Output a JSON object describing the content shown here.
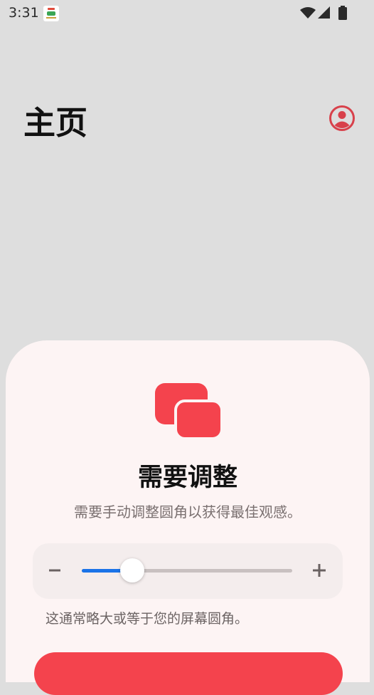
{
  "status_bar": {
    "time": "3:31",
    "icons": [
      "app-notification-icon",
      "wifi-icon",
      "signal-icon",
      "battery-icon"
    ]
  },
  "header": {
    "title": "主页",
    "account_icon": "account-circle-icon"
  },
  "sheet": {
    "title": "需要调整",
    "subtitle": "需要手动调整圆角以获得最佳观感。",
    "hint": "这通常略大或等于您的屏幕圆角。",
    "slider": {
      "value_fraction": 0.24,
      "decrease_icon": "minus-icon",
      "increase_icon": "plus-icon"
    },
    "primary_button_label": ""
  },
  "colors": {
    "background": "#dedede",
    "sheet": "#fdf4f4",
    "accent": "#f4434d",
    "slider_active": "#1a73e8"
  }
}
